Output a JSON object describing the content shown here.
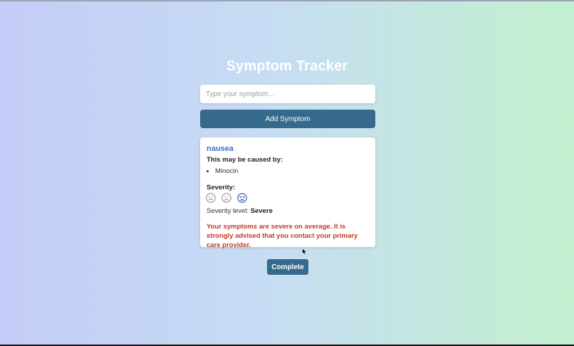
{
  "app": {
    "title": "Symptom Tracker"
  },
  "symptom_input": {
    "value": "",
    "placeholder": "Type your symptom..."
  },
  "add_button": {
    "label": "Add Symptom"
  },
  "symptom_card": {
    "name": "nausea",
    "caused_by_label": "This may be caused by:",
    "causes": [
      "Minocin"
    ],
    "severity_label": "Severity:",
    "severity_faces": [
      {
        "icon": "smile-face-icon",
        "selected": false
      },
      {
        "icon": "frown-face-icon",
        "selected": false
      },
      {
        "icon": "distressed-face-icon",
        "selected": true
      }
    ],
    "severity_level_label": "Severity level:",
    "severity_level_value": "Severe",
    "warning": "Your symptoms are severe on average. It is strongly advised that you contact your primary care provider."
  },
  "complete_button": {
    "label": "Complete"
  },
  "colors": {
    "accent": "#366a8c",
    "symptom_name": "#3f6fc4",
    "warning": "#c0392b",
    "selected_face": "#3f6fc4",
    "unselected_face": "#8a8a8a"
  }
}
